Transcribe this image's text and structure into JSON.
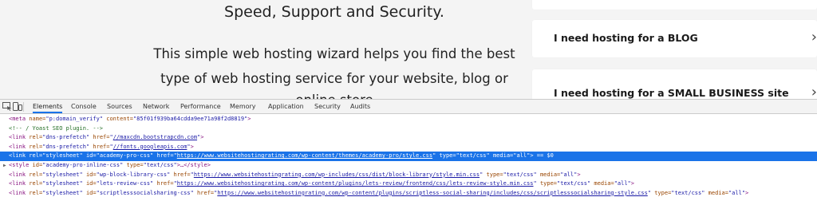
{
  "hero": {
    "heading": "Speed, Support and Security.",
    "line1": "This simple web hosting wizard helps you find the best",
    "line2": "type of web hosting service for your website, blog or",
    "line3": "online store"
  },
  "cards": {
    "blog": {
      "label": "I need hosting for a BLOG",
      "chevron": "›"
    },
    "business": {
      "label": "I need hosting for a SMALL BUSINESS site",
      "chevron": "›"
    }
  },
  "devtools": {
    "tabs": [
      "Elements",
      "Console",
      "Sources",
      "Network",
      "Performance",
      "Memory",
      "Application",
      "Security",
      "Audits"
    ],
    "active_tab": "Elements",
    "icons": [
      "inspect-element-icon",
      "device-toolbar-icon"
    ],
    "colors": {
      "accent": "#1a73e8",
      "tag": "#881280",
      "attr_name": "#994500",
      "attr_value": "#1a1aa6",
      "comment": "#236e25"
    },
    "selected_suffix": "== $0",
    "lines": [
      {
        "tag_open": "<meta",
        "a1": "name=",
        "v1": "\"p:domain_verify\"",
        "a2": "content=",
        "v2": "\"85f01f939ba64cdda9ee71a98f2d8819\"",
        "tag_close": ">"
      },
      {
        "comment": "<!-- / Yoast SEO plugin. -->"
      },
      {
        "tag_open": "<link",
        "a1": "rel=",
        "v1": "\"dns-prefetch\"",
        "a2": "href=",
        "q1": "\"",
        "link": "//maxcdn.bootstrapcdn.com",
        "q2": "\"",
        "tag_close": ">"
      },
      {
        "tag_open": "<link",
        "a1": "rel=",
        "v1": "\"dns-prefetch\"",
        "a2": "href=",
        "q1": "\"",
        "link": "//fonts.googleapis.com",
        "q2": "\"",
        "tag_close": ">"
      },
      {
        "tag_open": "<link",
        "a1": "rel=",
        "v1": "\"stylesheet\"",
        "a2": "id=",
        "v2": "\"academy-pro-css\"",
        "a3": "href=",
        "q1": "\"",
        "link": "https://www.websitehostingrating.com/wp-content/themes/academy-pro/style.css",
        "q2": "\"",
        "a4": "type=",
        "v4": "\"text/css\"",
        "a5": "media=",
        "v5": "\"all\"",
        "tag_close": ">"
      },
      {
        "tag_open": "<style",
        "a1": "id=",
        "v1": "\"academy-pro-inline-css\"",
        "a2": "type=",
        "v2": "\"text/css\"",
        "ellipsis": ">…</",
        "tag_close": "style>"
      },
      {
        "tag_open": "<link",
        "a1": "rel=",
        "v1": "\"stylesheet\"",
        "a2": "id=",
        "v2": "\"wp-block-library-css\"",
        "a3": "href=",
        "q1": "\"",
        "link": "https://www.websitehostingrating.com/wp-includes/css/dist/block-library/style.min.css",
        "q2": "\"",
        "a4": "type=",
        "v4": "\"text/css\"",
        "a5": "media=",
        "v5": "\"all\"",
        "tag_close": ">"
      },
      {
        "tag_open": "<link",
        "a1": "rel=",
        "v1": "\"stylesheet\"",
        "a2": "id=",
        "v2": "\"lets-review-css\"",
        "a3": "href=",
        "q1": "\"",
        "link": "https://www.websitehostingrating.com/wp-content/plugins/lets-review/frontend/css/lets-review-style.min.css",
        "q2": "\"",
        "a4": "type=",
        "v4": "\"text/css\"",
        "a5": "media=",
        "v5": "\"all\"",
        "tag_close": ">"
      },
      {
        "tag_open": "<link",
        "a1": "rel=",
        "v1": "\"stylesheet\"",
        "a2": "id=",
        "v2": "\"scriptlesssocialsharing-css\"",
        "a3": "href=",
        "q1": "\"",
        "link": "https://www.websitehostingrating.com/wp-content/plugins/scriptless-social-sharing/includes/css/scriptlesssocialsharing-style.css",
        "q2": "\"",
        "a4": "type=",
        "v4": "\"text/css\"",
        "a5": "media=",
        "v5": "\"all\"",
        "tag_close": ">"
      }
    ]
  }
}
